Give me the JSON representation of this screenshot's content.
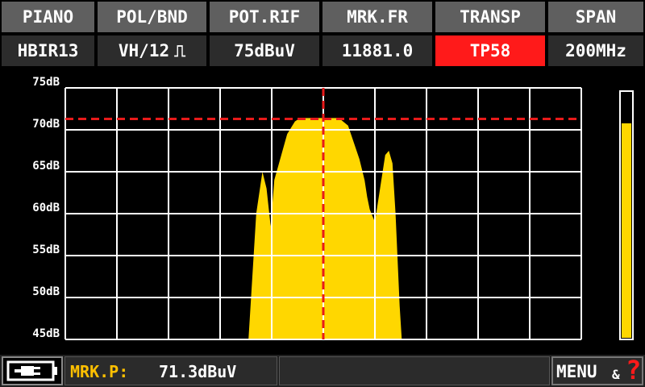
{
  "header": {
    "labels": [
      "PIANO",
      "POL/BND",
      "POT.RIF",
      "MRK.FR",
      "TRANSP",
      "SPAN"
    ],
    "values": [
      "HBIR13",
      "VH/12",
      "75dBuV",
      "11881.0",
      "TP58",
      "200MHz"
    ],
    "band_glyph": "⎍",
    "highlight_color": "#ff1a1a"
  },
  "y_axis": {
    "ticks": [
      "75dB",
      "70dB",
      "65dB",
      "60dB",
      "55dB",
      "50dB",
      "45dB"
    ],
    "range_db": [
      45,
      75
    ]
  },
  "spectrum": {
    "fill_color": "#ffd700",
    "grid_color": "#ffffff",
    "grid_columns": 10,
    "grid_rows": 6,
    "profile": [
      [
        0.355,
        45
      ],
      [
        0.37,
        60
      ],
      [
        0.382,
        65
      ],
      [
        0.39,
        63
      ],
      [
        0.398,
        58.5
      ],
      [
        0.405,
        64
      ],
      [
        0.43,
        69.5
      ],
      [
        0.445,
        71
      ],
      [
        0.455,
        71.4
      ],
      [
        0.475,
        71.4
      ],
      [
        0.53,
        71.4
      ],
      [
        0.548,
        70.5
      ],
      [
        0.57,
        66.5
      ],
      [
        0.58,
        64
      ],
      [
        0.585,
        62
      ],
      [
        0.59,
        60.5
      ],
      [
        0.6,
        59
      ],
      [
        0.61,
        63
      ],
      [
        0.62,
        67
      ],
      [
        0.627,
        67.5
      ],
      [
        0.634,
        66
      ],
      [
        0.64,
        60
      ],
      [
        0.648,
        49
      ],
      [
        0.652,
        45
      ]
    ],
    "marker_x_fraction": 0.5,
    "marker_level_db": 71.3,
    "marker_color": "#e81a1a"
  },
  "level_bar": {
    "fill_fraction": 0.87,
    "fill_color": "#ffd700"
  },
  "footer": {
    "battery_icon": "battery-plug-icon",
    "mrk_label": "MRK.P:",
    "mrk_value": "71.3dBuV",
    "mrk_color": "#ffc000",
    "menu_label": "MENU",
    "amp": "&",
    "help": "?",
    "help_color": "#ff1a1a"
  }
}
